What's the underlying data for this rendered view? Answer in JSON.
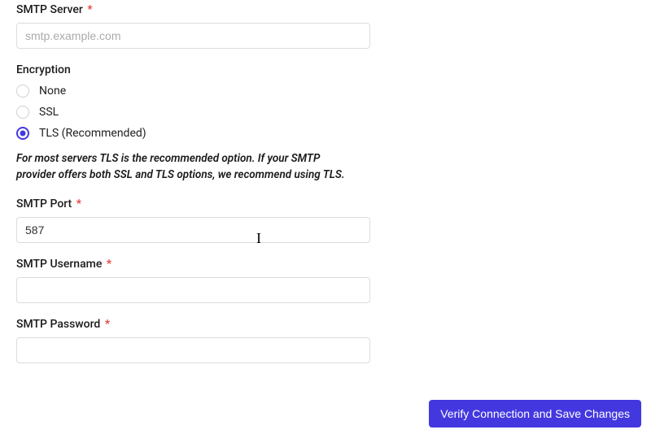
{
  "server": {
    "label": "SMTP Server",
    "placeholder": "smtp.example.com",
    "value": ""
  },
  "encryption": {
    "label": "Encryption",
    "options": {
      "none": "None",
      "ssl": "SSL",
      "tls": "TLS (Recommended)"
    },
    "help_text": "For most servers TLS is the recommended option. If your SMTP provider offers both SSL and TLS options, we recommend using TLS."
  },
  "port": {
    "label": "SMTP Port",
    "value": "587"
  },
  "username": {
    "label": "SMTP Username",
    "value": ""
  },
  "password": {
    "label": "SMTP Password",
    "value": ""
  },
  "buttons": {
    "verify_save": "Verify Connection and Save Changes"
  },
  "required": "*"
}
